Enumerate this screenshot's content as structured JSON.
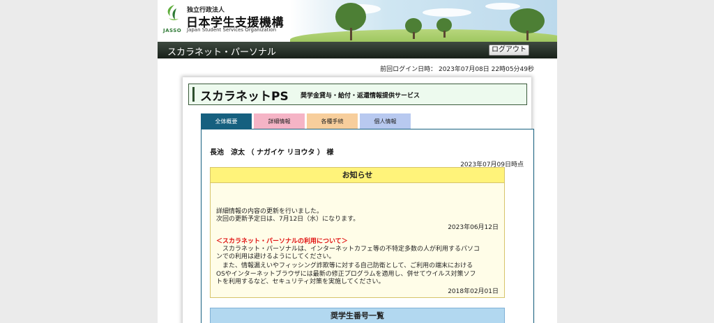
{
  "header": {
    "org_small": "独立行政法人",
    "org_name": "日本学生支援機構",
    "org_english": "Japan Student Services Organization",
    "logo_text": "JASSO"
  },
  "titlebar": {
    "site_title": "スカラネット・パーソナル",
    "logout_label": "ログアウト"
  },
  "last_login": "前回ログイン日時： 2023年07月08日 22時05分49秒",
  "service": {
    "name": "スカラネットPS",
    "description": "奨学金貸与・給付・返還情報提供サービス"
  },
  "tabs": [
    {
      "label": "全体概要",
      "active": true
    },
    {
      "label": "詳細情報",
      "active": false
    },
    {
      "label": "各種手続",
      "active": false
    },
    {
      "label": "個人情報",
      "active": false
    }
  ],
  "user": {
    "name_line": "長池　涼太 （ ナガイケ リヨウタ ） 様",
    "as_of": "2023年07月09日時点"
  },
  "notice": {
    "title": "お知らせ",
    "item1_line1": "詳細情報の内容の更新を行いました。",
    "item1_line2": "次回の更新予定日は、7月12日（水）になります。",
    "item1_date": "2023年06月12日",
    "item2_heading": "＜スカラネット・パーソナルの利用について＞",
    "item2_line1": "　スカラネット・パーソナルは、インターネットカフェ等の不特定多数の人が利用するパソコ",
    "item2_line2": "ンでの利用は避けるようにしてください。",
    "item2_line3": "　また、情報漏えいやフィッシング詐欺等に対する自己防衛として、ご利用の端末における",
    "item2_line4": "OSやインターネットブラウザには最新の修正プログラムを適用し、併せてウイルス対策ソフ",
    "item2_line5": "トを利用するなど、セキュリティ対策を実施してください。",
    "item2_date": "2018年02月01日"
  },
  "scholarship": {
    "title": "奨学生番号一覧"
  },
  "colors": {
    "tab_active": "#16607f",
    "tab_detail": "#f5b4c6",
    "tab_procedure": "#f7ce9c",
    "tab_personal": "#b8c9f0",
    "notice_header": "#fff37a",
    "notice_red": "#e01010",
    "scholar_header": "#b2d8f0"
  }
}
